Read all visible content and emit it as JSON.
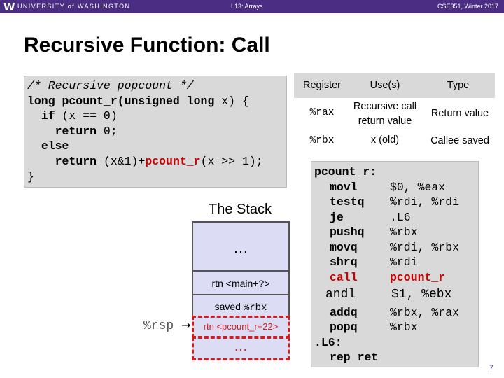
{
  "header": {
    "logo": "W",
    "university": "UNIVERSITY of WASHINGTON",
    "lecture": "L13: Arrays",
    "course": "CSE351, Winter 2017"
  },
  "slide": {
    "title": "Recursive Function:  Call",
    "page_number": "7"
  },
  "code": {
    "line1": "/* Recursive popcount */",
    "line2_kw": "long pcount_r(unsigned long",
    "line2_rest": " x) {",
    "line3_kw": "if",
    "line3_rest": " (x == 0)",
    "line4_kw": "return",
    "line4_rest": " 0;",
    "line5_kw": "else",
    "line6_kw": "return",
    "line6_a": " (x&1)+",
    "line6_red": "pcount_r",
    "line6_b": "(x >> 1);",
    "line7": "}"
  },
  "stack": {
    "title": "The Stack",
    "ellipsis_top": "…",
    "frame1": "rtn <main+?>",
    "frame2_text": "saved ",
    "frame2_reg": "%rbx",
    "frame3": "rtn <pcount_r+22>",
    "ellipsis_bottom": "…",
    "rsp_label": "%rsp",
    "arrow": "→"
  },
  "registers": {
    "headers": [
      "Register",
      "Use(s)",
      "Type"
    ],
    "rows": [
      {
        "reg": "%rax",
        "use_line1": "Recursive call",
        "use_line2": "return value",
        "type": "Return value"
      },
      {
        "reg": "%rbx",
        "use_line1": "x (old)",
        "use_line2": "",
        "type": "Callee saved"
      }
    ]
  },
  "assembly": [
    {
      "label": "pcount_r:",
      "op": "",
      "args": ""
    },
    {
      "label": "",
      "op": "movl",
      "args": "$0, %eax"
    },
    {
      "label": "",
      "op": "testq",
      "args": "%rdi, %rdi"
    },
    {
      "label": "",
      "op": "je",
      "args": ".L6"
    },
    {
      "label": "",
      "op": "pushq",
      "args": "%rbx"
    },
    {
      "label": "",
      "op": "movq",
      "args": "%rdi, %rbx"
    },
    {
      "label": "",
      "op": "shrq",
      "args": "%rdi"
    },
    {
      "label": "",
      "op": "call",
      "args": "pcount_r"
    },
    {
      "label": "",
      "op": "andl",
      "args": "$1, %ebx"
    },
    {
      "label": "",
      "op": "addq",
      "args": "%rbx, %rax"
    },
    {
      "label": "",
      "op": "popq",
      "args": "%rbx"
    },
    {
      "label": ".L6:",
      "op": "",
      "args": ""
    },
    {
      "label": "",
      "op": "rep ret",
      "args": ""
    }
  ]
}
